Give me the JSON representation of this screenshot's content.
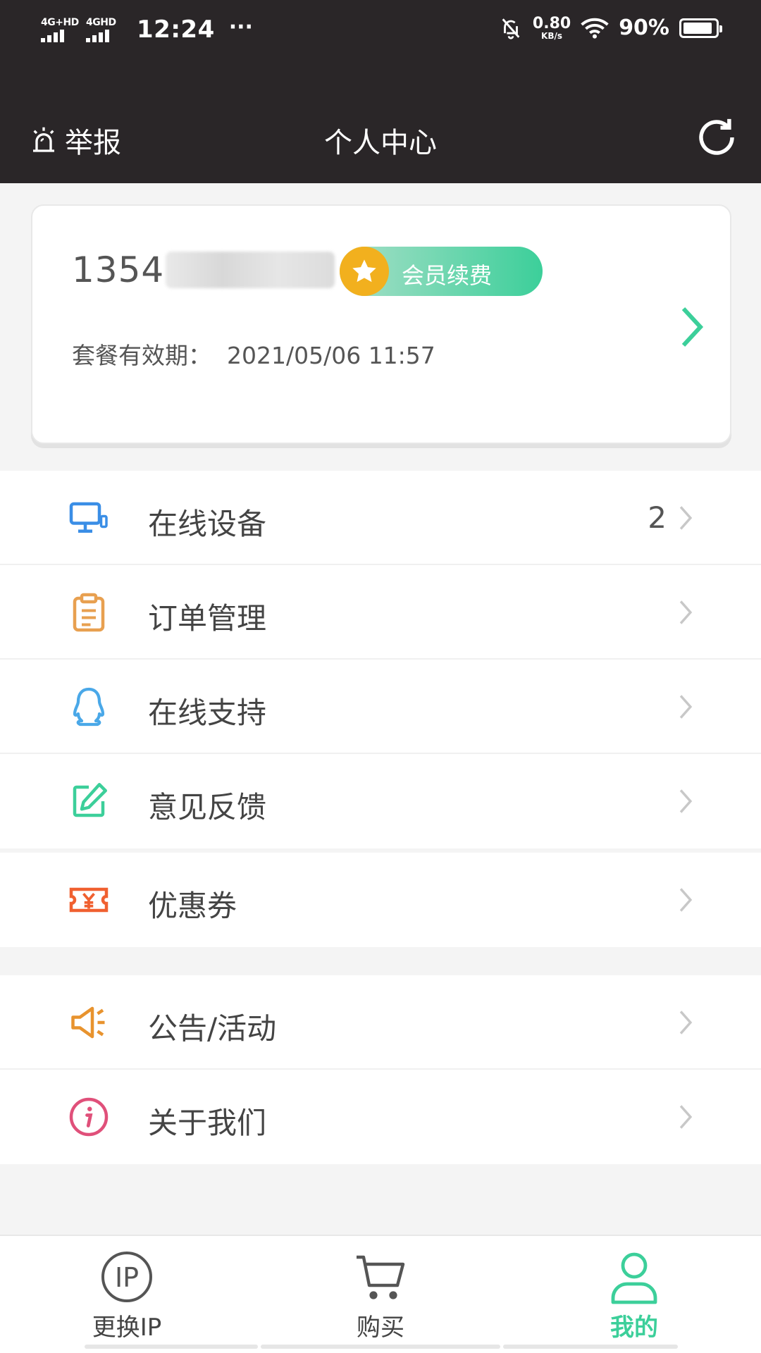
{
  "status_bar": {
    "signal1_label": "4G+HD",
    "signal2_label": "4GHD",
    "time": "12:24",
    "dots": "···",
    "net_speed_value": "0.80",
    "net_speed_unit": "KB/s",
    "battery_pct": "90%"
  },
  "header": {
    "report_label": "举报",
    "title": "个人中心"
  },
  "account": {
    "phone_visible": "1354",
    "renew_label": "会员续费",
    "expiry_label": "套餐有效期：",
    "expiry_value": "2021/05/06 11:57"
  },
  "menu": {
    "online_devices": {
      "label": "在线设备",
      "count": "2",
      "icon": "monitor-icon"
    },
    "orders": {
      "label": "订单管理",
      "icon": "clipboard-icon"
    },
    "support": {
      "label": "在线支持",
      "icon": "qq-penguin-icon"
    },
    "feedback": {
      "label": "意见反馈",
      "icon": "edit-note-icon"
    },
    "coupons": {
      "label": "优惠券",
      "icon": "coupon-ticket-icon"
    },
    "announcements": {
      "label": "公告/活动",
      "icon": "megaphone-icon"
    },
    "about": {
      "label": "关于我们",
      "icon": "info-icon"
    }
  },
  "bottom_nav": {
    "change_ip": "更换IP",
    "buy": "购买",
    "mine": "我的"
  },
  "colors": {
    "dark_bar": "#2a2628",
    "accent_green": "#3ccf9a",
    "star_gold": "#f2b01e",
    "device_blue": "#3a8ee6",
    "order_orange": "#e8a050",
    "support_blue": "#4aa8e8",
    "feedback_green": "#3ccf9a",
    "coupon_red": "#f06030",
    "announce_orange": "#e8932e",
    "about_pink": "#e0507a"
  }
}
